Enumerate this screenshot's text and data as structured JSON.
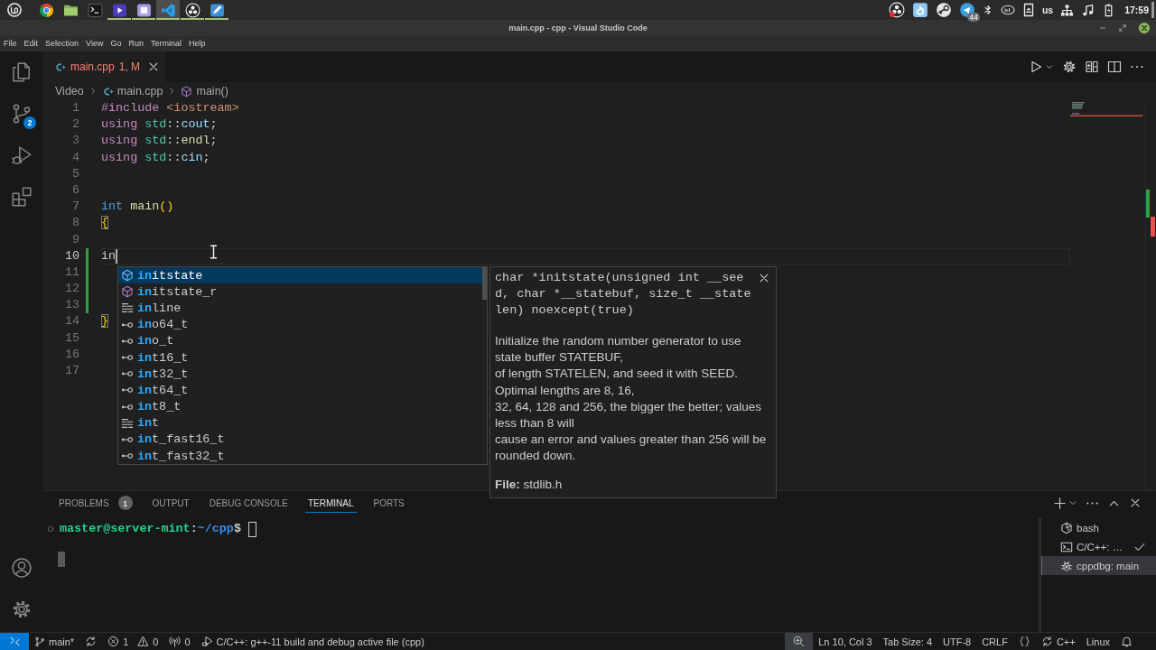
{
  "system_panel": {
    "apps": [
      {
        "kind": "browser",
        "running": false,
        "active": false
      },
      {
        "kind": "files",
        "running": false,
        "active": false
      },
      {
        "kind": "terminal",
        "running": false,
        "active": false
      },
      {
        "kind": "media",
        "running": true,
        "active": false
      },
      {
        "kind": "notes",
        "running": true,
        "active": false
      },
      {
        "kind": "code",
        "running": true,
        "active": true
      },
      {
        "kind": "recorder",
        "running": true,
        "active": false
      },
      {
        "kind": "writer",
        "running": true,
        "active": false
      }
    ],
    "tray": [
      {
        "kind": "recorder"
      },
      {
        "kind": "sync"
      },
      {
        "kind": "game"
      },
      {
        "kind": "chat",
        "badge": "44"
      },
      {
        "kind": "bluetooth"
      },
      {
        "kind": "chip"
      },
      {
        "kind": "drive"
      },
      {
        "kind": "keyboard",
        "label": "us"
      },
      {
        "kind": "network"
      },
      {
        "kind": "sound"
      },
      {
        "kind": "battery"
      }
    ],
    "clock": "17:59"
  },
  "window": {
    "title": "main.cpp - cpp - Visual Studio Code"
  },
  "menu": [
    "File",
    "Edit",
    "Selection",
    "View",
    "Go",
    "Run",
    "Terminal",
    "Help"
  ],
  "activity_bar": {
    "top": [
      {
        "kind": "explorer"
      },
      {
        "kind": "source_control",
        "badge": "2"
      },
      {
        "kind": "run_debug"
      },
      {
        "kind": "extensions"
      }
    ],
    "bottom": [
      {
        "kind": "accounts"
      },
      {
        "kind": "settings"
      }
    ]
  },
  "editor": {
    "tabs": [
      {
        "label": "main.cpp",
        "decoration": "1, M",
        "selected": true,
        "has_errors": true
      }
    ],
    "breadcrumb": [
      {
        "label": "Video",
        "kind": "folder"
      },
      {
        "label": "main.cpp",
        "kind": "file"
      },
      {
        "label": "main()",
        "kind": "function"
      }
    ],
    "lines": [
      {
        "number": "1",
        "current": false,
        "modified": false,
        "tokens": [
          {
            "text": "#include",
            "kind": "directive"
          },
          {
            "text": " <iostream>",
            "kind": "string"
          }
        ]
      },
      {
        "number": "2",
        "current": false,
        "modified": false,
        "tokens": [
          {
            "text": "using",
            "kind": "control"
          },
          {
            "text": " std",
            "kind": "namespace"
          },
          {
            "text": "::",
            "kind": "plain"
          },
          {
            "text": "cout",
            "kind": "variable"
          },
          {
            "text": ";",
            "kind": "plain"
          }
        ]
      },
      {
        "number": "3",
        "current": false,
        "modified": false,
        "tokens": [
          {
            "text": "using",
            "kind": "control"
          },
          {
            "text": " std",
            "kind": "namespace"
          },
          {
            "text": "::",
            "kind": "plain"
          },
          {
            "text": "endl",
            "kind": "function"
          },
          {
            "text": ";",
            "kind": "plain"
          }
        ]
      },
      {
        "number": "4",
        "current": false,
        "modified": false,
        "tokens": [
          {
            "text": "using",
            "kind": "control"
          },
          {
            "text": " std",
            "kind": "namespace"
          },
          {
            "text": "::",
            "kind": "plain"
          },
          {
            "text": "cin",
            "kind": "variable"
          },
          {
            "text": ";",
            "kind": "plain"
          }
        ]
      },
      {
        "number": "5",
        "current": false,
        "modified": false
      },
      {
        "number": "6",
        "current": false,
        "modified": false
      },
      {
        "number": "7",
        "current": false,
        "modified": false,
        "tokens": [
          {
            "text": "int",
            "kind": "type"
          },
          {
            "text": " main",
            "kind": "function"
          },
          {
            "text": "()",
            "kind": "bracket"
          }
        ]
      },
      {
        "number": "8",
        "current": false,
        "modified": false,
        "tokens": [
          {
            "text": "{",
            "kind": "bracket_match"
          }
        ]
      },
      {
        "number": "9",
        "current": false,
        "modified": false
      },
      {
        "number": "10",
        "current": true,
        "modified": true,
        "tokens": [
          {
            "text": "in",
            "kind": "plain"
          }
        ]
      },
      {
        "number": "11",
        "current": false,
        "modified": true
      },
      {
        "number": "12",
        "current": false,
        "modified": true
      },
      {
        "number": "13",
        "current": false,
        "modified": true
      },
      {
        "number": "14",
        "current": false,
        "modified": false,
        "tokens": [
          {
            "text": "}",
            "kind": "bracket_match"
          }
        ]
      },
      {
        "number": "15",
        "current": false,
        "modified": false
      },
      {
        "number": "16",
        "current": false,
        "modified": false
      },
      {
        "number": "17",
        "current": false,
        "modified": false
      }
    ],
    "suggestions": [
      {
        "label": "**in**itstate",
        "kind": "function",
        "selected": true
      },
      {
        "label": "**in**itstate_r",
        "kind": "function",
        "selected": false
      },
      {
        "label": "**in**line",
        "kind": "keyword",
        "selected": false
      },
      {
        "label": "**in**o64_t",
        "kind": "typedef",
        "selected": false
      },
      {
        "label": "**in**o_t",
        "kind": "typedef",
        "selected": false
      },
      {
        "label": "**in**t16_t",
        "kind": "typedef",
        "selected": false
      },
      {
        "label": "**in**t32_t",
        "kind": "typedef",
        "selected": false
      },
      {
        "label": "**in**t64_t",
        "kind": "typedef",
        "selected": false
      },
      {
        "label": "**in**t8_t",
        "kind": "typedef",
        "selected": false
      },
      {
        "label": "**in**t",
        "kind": "keyword",
        "selected": false
      },
      {
        "label": "**in**t_fast16_t",
        "kind": "typedef",
        "selected": false
      },
      {
        "label": "**in**t_fast32_t",
        "kind": "typedef",
        "selected": false
      }
    ],
    "details": {
      "signature": "char *initstate(unsigned int __seed, char *__statebuf, size_t __statelen) noexcept(true)",
      "documentation": "Initialize the random number generator to use state buffer STATEBUF,\nof length STATELEN, and seed it with SEED.\nOptimal lengths are 8, 16,\n32, 64, 128 and 256, the bigger the better; values less than 8 will\ncause an error and values greater than 256 will be rounded down.",
      "source": "**File:** stdlib.h"
    }
  },
  "panel": {
    "tabs": [
      {
        "label": "PROBLEMS",
        "badge": "1",
        "selected": false
      },
      {
        "label": "OUTPUT",
        "selected": false
      },
      {
        "label": "DEBUG CONSOLE",
        "selected": false
      },
      {
        "label": "TERMINAL",
        "selected": true
      },
      {
        "label": "PORTS",
        "selected": false
      }
    ],
    "terminal": {
      "prompt": {
        "user_host": "master@server-mint",
        "separator": ":",
        "path": "~/cpp",
        "symbol": "$"
      }
    },
    "instances": [
      {
        "label": "bash",
        "kind": "bash",
        "selected": false,
        "succeeded": false
      },
      {
        "label": "C/C++: …",
        "kind": "task",
        "selected": false,
        "succeeded": true
      },
      {
        "label": "cppdbg: main",
        "kind": "debug",
        "selected": true,
        "succeeded": false
      }
    ]
  },
  "status_bar": {
    "left": [
      {
        "kind": "remote"
      },
      {
        "kind": "branch",
        "text": "main*"
      },
      {
        "kind": "sync"
      },
      {
        "kind": "problems",
        "errors": "1",
        "warnings": "0"
      },
      {
        "kind": "ports",
        "text": "0"
      },
      {
        "kind": "launch",
        "text": "C/C++: g++-11 build and debug active file (cpp)"
      }
    ],
    "right": [
      {
        "kind": "zoom"
      },
      {
        "kind": "text",
        "text": "Ln 10, Col 3"
      },
      {
        "kind": "text",
        "text": "Tab Size: 4"
      },
      {
        "kind": "text",
        "text": "UTF-8"
      },
      {
        "kind": "text",
        "text": "CRLF"
      },
      {
        "kind": "braces"
      },
      {
        "kind": "language",
        "text": "C++"
      },
      {
        "kind": "text",
        "text": "Linux"
      },
      {
        "kind": "bell"
      }
    ]
  }
}
